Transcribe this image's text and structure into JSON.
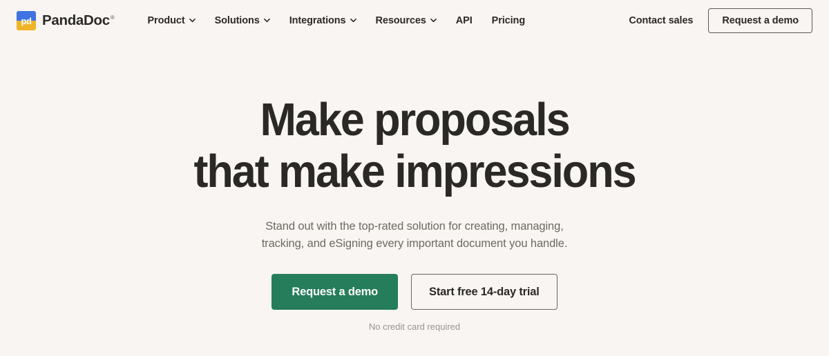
{
  "theme": {
    "background": "#f8f5f2",
    "text_primary": "#2b2926",
    "text_muted": "#6e6861",
    "text_faint": "#9a948d",
    "accent_green": "#257d5b",
    "logo_blue": "#3f73e3",
    "logo_yellow": "#f0b429",
    "border": "#5d5750"
  },
  "header": {
    "logo": {
      "icon": "pandadoc-logo-icon",
      "mark_text": "pd",
      "brand_name": "PandaDoc",
      "trademark": "®"
    },
    "nav": [
      {
        "label": "Product",
        "has_dropdown": true,
        "icon": "chevron-down-icon"
      },
      {
        "label": "Solutions",
        "has_dropdown": true,
        "icon": "chevron-down-icon"
      },
      {
        "label": "Integrations",
        "has_dropdown": true,
        "icon": "chevron-down-icon"
      },
      {
        "label": "Resources",
        "has_dropdown": true,
        "icon": "chevron-down-icon"
      },
      {
        "label": "API",
        "has_dropdown": false,
        "icon": ""
      },
      {
        "label": "Pricing",
        "has_dropdown": false,
        "icon": ""
      }
    ],
    "contact_sales_label": "Contact sales",
    "request_demo_label": "Request a demo"
  },
  "hero": {
    "title_line1": "Make proposals",
    "title_line2": "that make impressions",
    "subtitle_line1": "Stand out with the top-rated solution for creating, managing,",
    "subtitle_line2": "tracking, and eSigning every important document you handle.",
    "primary_cta": "Request a demo",
    "secondary_cta": "Start free 14-day trial",
    "note": "No credit card required"
  }
}
